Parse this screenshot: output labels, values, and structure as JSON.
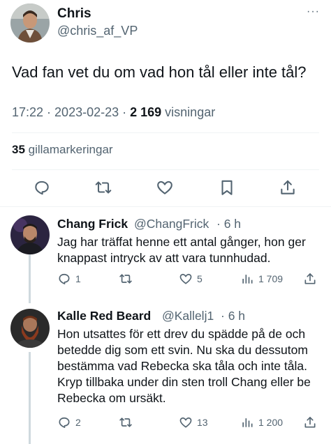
{
  "main_tweet": {
    "display_name": "Chris",
    "handle": "@chris_af_VP",
    "more_label": "···",
    "text": "Vad fan vet du om vad hon tål eller inte tål?",
    "time": "17:22",
    "sep1": " · ",
    "date": "2023-02-23",
    "sep2": " · ",
    "views_count": "2 169",
    "views_label": " visningar",
    "likes_count": "35",
    "likes_label": " gillamarkeringar"
  },
  "action_icons": [
    "reply-icon",
    "retweet-icon",
    "like-icon",
    "bookmark-icon",
    "share-icon"
  ],
  "replies": [
    {
      "display_name": "Chang Frick",
      "handle": "@ChangFrick",
      "time": "· 6 h",
      "text": "Jag har träffat henne ett antal gånger, hon ger knappast intryck av att vara tunnhudad.",
      "reply_count": "1",
      "retweet_count": "",
      "like_count": "5",
      "view_count": "1 709"
    },
    {
      "display_name": "Kalle Red Beard",
      "handle": "@Kallelj1",
      "time": "· 6 h",
      "text": "Hon utsattes för ett drev du spädde på de och betedde dig som ett svin. Nu ska du dessutom bestämma vad Rebecka ska tåla och inte tåla. Kryp tillbaka under din sten troll Chang eller be Rebecka om ursäkt.",
      "reply_count": "2",
      "retweet_count": "",
      "like_count": "13",
      "view_count": "1 200"
    }
  ],
  "colors": {
    "text_primary": "#0f1419",
    "text_secondary": "#536471",
    "divider": "#eff3f4",
    "thread_line": "#cfd9de"
  }
}
